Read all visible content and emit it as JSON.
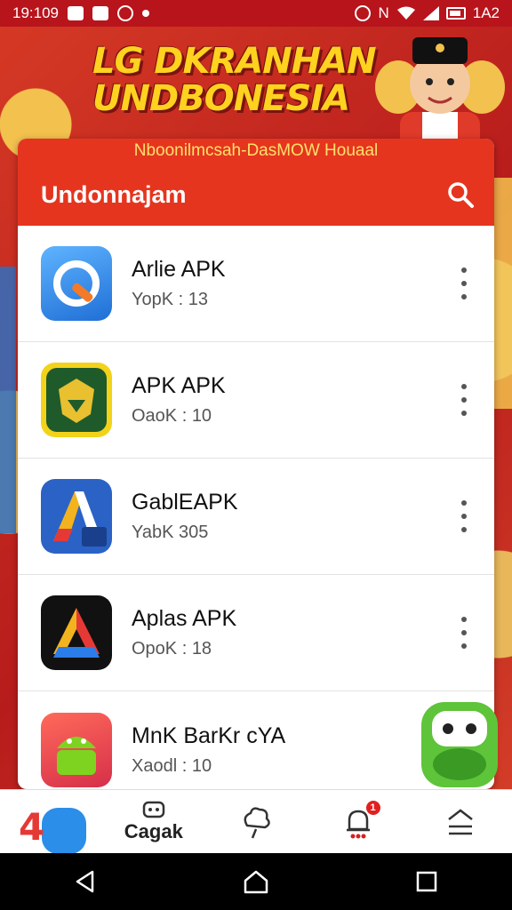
{
  "status_bar": {
    "time": "19:109",
    "right_text": "1A2",
    "network_letter": "N"
  },
  "banner": {
    "title_line1": "LG DKRANHAN",
    "title_line2": "UNDBONESIA"
  },
  "card": {
    "subtitle": "Nboonilmcsah-DasMOW Houaal",
    "header_title": "Undonnajam",
    "search_icon": "search-icon"
  },
  "apps": [
    {
      "name": "Arlie APK",
      "meta": "YopK : 13",
      "icon": "app-icon-blue-q",
      "color": "#2f8fe8"
    },
    {
      "name": "APK APK",
      "meta": "OaoK : 10",
      "icon": "app-icon-green-emblem",
      "color": "#1f5a2a"
    },
    {
      "name": "GablEAPK",
      "meta": "YabK 305",
      "icon": "app-icon-blue-a",
      "color": "#2b62c6"
    },
    {
      "name": "Aplas APK",
      "meta": "OpoK : 18",
      "icon": "app-icon-black-a",
      "color": "#111111"
    },
    {
      "name": "MnK BarKr cYA",
      "meta": "Xaodl : 10",
      "icon": "app-icon-android",
      "color": "#e8423a"
    }
  ],
  "bottom_nav": {
    "items": [
      {
        "label": "",
        "icon": "home-logo-icon"
      },
      {
        "label": "Cagak",
        "icon": "gamepad-icon"
      },
      {
        "label": "",
        "icon": "cloud-icon"
      },
      {
        "label": "",
        "icon": "bell-icon",
        "badge": "1"
      },
      {
        "label": "",
        "icon": "menu-icon"
      }
    ]
  },
  "system_nav": {
    "back": "back-icon",
    "home": "home-icon",
    "recents": "recents-icon"
  },
  "colors": {
    "header_red": "#e5351f",
    "banner_yellow": "#ffd21f",
    "status_bar": "#b8141c"
  }
}
